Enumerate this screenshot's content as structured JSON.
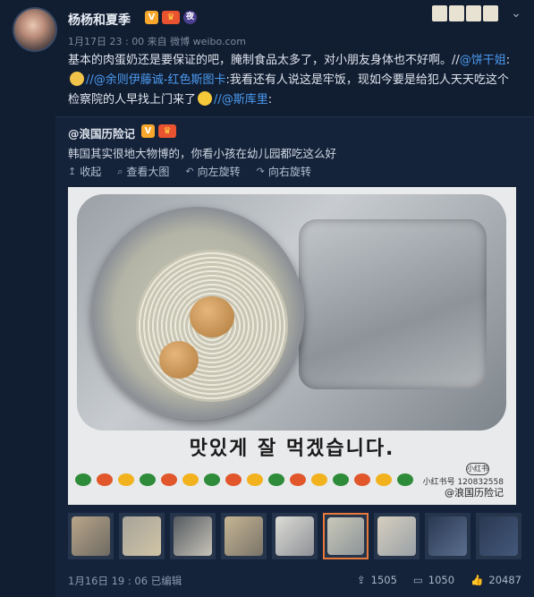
{
  "post": {
    "username": "杨杨和夏季",
    "meta": "1月17日 23 : 00 来自 微博 weibo.com",
    "content_1": "基本的肉蛋奶还是要保证的吧，腌制食品太多了，对小朋友身体也不好啊。//",
    "mention_1": "@饼干姐",
    "content_2": ":",
    "mention_2": "//@余则伊藤诚-红色斯图卡",
    "content_3": ":我看还有人说这是牢饭，现如今要是给犯人天天吃这个检察院的人早找上门来了",
    "mention_3": "//@斯库里",
    "content_4": ":"
  },
  "repost": {
    "username": "@浪国历险记",
    "text": "韩国其实很地大物博的，你看小孩在幼儿园都吃这么好",
    "tools": {
      "collapse": "收起",
      "view_large": "查看大图",
      "rotate_left": "向左旋转",
      "rotate_right": "向右旋转"
    },
    "photo": {
      "slogan": "맛있게 잘 먹겠습니다.",
      "watermark_logo": "小红书",
      "watermark_id": "小红书号 120832558",
      "watermark_user": "@浪国历险记"
    },
    "footer": {
      "date": "1月16日 19 : 06  已编辑",
      "shares": "1505",
      "comments": "1050",
      "likes": "20487"
    }
  },
  "icons": {
    "verified": "V",
    "crown": "♛",
    "circle_badge": "夜",
    "chevron": "⌄",
    "collapse": "↥",
    "search": "⌕",
    "rotate_left": "↶",
    "rotate_right": "↷",
    "share": "⇪",
    "comment": "▭",
    "like": "👍"
  },
  "colors": {
    "link": "#4c9bf0",
    "active_thumb_border": "#e8793b",
    "background": "#111d31"
  }
}
